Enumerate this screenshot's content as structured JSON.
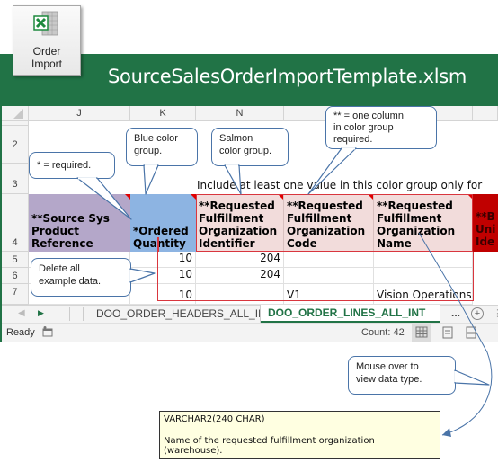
{
  "ribbon_button": {
    "label": "Order\nImport",
    "icon": "excel-icon"
  },
  "window": {
    "title": "SourceSalesOrderImportTemplate.xlsm"
  },
  "columns": [
    "J",
    "K",
    "N"
  ],
  "rows": [
    "2",
    "3",
    "4",
    "5",
    "6",
    "7"
  ],
  "instruction_row3": "Include at least one value in this color group only for",
  "headers": {
    "source_product": "**Source Sys\nProduct\nReference",
    "ordered_quantity": "*Ordered\nQuantity",
    "fulfillment_org_id": "**Requested\nFulfillment\nOrganization\nIdentifier",
    "fulfillment_org_code": "**Requested\nFulfillment\nOrganization\nCode",
    "fulfillment_org_name": "**Requested\nFulfillment\nOrganization\nName",
    "business_unit": "**B\nUni\nIde"
  },
  "data_rows": [
    {
      "quantity": "10",
      "org_id": "204",
      "org_code": "",
      "org_name": ""
    },
    {
      "quantity": "10",
      "org_id": "204",
      "org_code": "",
      "org_name": ""
    },
    {
      "quantity": "10",
      "org_id": "",
      "org_code": "V1",
      "org_name": "Vision Operations"
    }
  ],
  "callouts": {
    "required": "* = required.",
    "blue_group": "Blue color\ngroup.",
    "salmon_group": "Salmon\ncolor group.",
    "one_column": "** = one column\nin color group\nrequired.",
    "delete_data": "Delete all\nexample data.",
    "mouse_over": "Mouse over to\nview data type."
  },
  "sheet_tabs": [
    {
      "label": "DOO_ORDER_HEADERS_ALL_INT",
      "active": false
    },
    {
      "label": "DOO_ORDER_LINES_ALL_INT",
      "active": true
    }
  ],
  "tab_more": "...",
  "status": {
    "ready": "Ready",
    "count": "Count: 42"
  },
  "tooltip": {
    "type": "VARCHAR2(240 CHAR)",
    "description": "Name of the requested fulfillment organization (warehouse)."
  },
  "colors": {
    "excel_green": "#217346",
    "purple_group": "#b4a7c9",
    "blue_group": "#8db4e2",
    "salmon_group": "#f2dcdb",
    "red_group": "#c00000",
    "highlight_border": "#d9363e",
    "callout_border": "#4a74a8"
  }
}
